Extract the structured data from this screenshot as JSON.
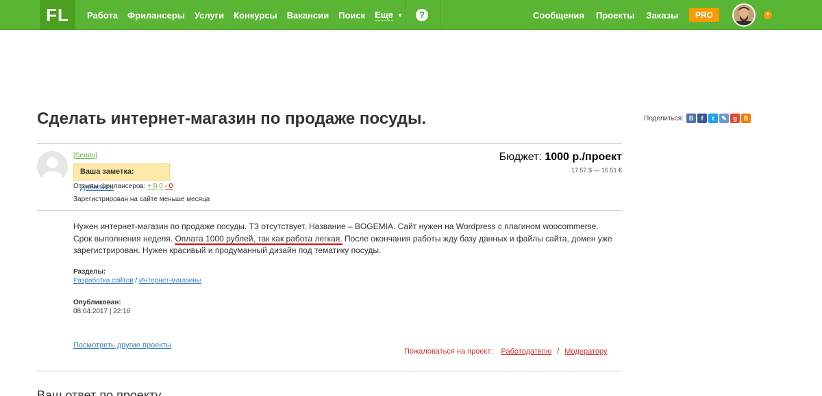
{
  "topbar": {
    "logo": "FL",
    "nav": [
      "Работа",
      "Фрилансеры",
      "Услуги",
      "Конкурсы",
      "Вакансии",
      "Поиск"
    ],
    "more": "Еще",
    "help": "?",
    "right_nav": [
      "Сообщения",
      "Проекты",
      "Заказы"
    ],
    "pro": "PRO"
  },
  "project": {
    "title": "Сделать интернет-магазин по продаже посуды.",
    "share_label": "Поделиться:",
    "share_buttons": [
      {
        "icon": "vk-icon",
        "glyph": "В",
        "color": "#4a76a8"
      },
      {
        "icon": "facebook-icon",
        "glyph": "f",
        "color": "#3b5998"
      },
      {
        "icon": "twitter-icon",
        "glyph": "t",
        "color": "#1da1f2"
      },
      {
        "icon": "link-icon",
        "glyph": "✎",
        "color": "#6c9bd2"
      },
      {
        "icon": "google-plus-icon",
        "glyph": "g",
        "color": "#dd4b39"
      },
      {
        "icon": "blogger-icon",
        "glyph": "B",
        "color": "#f57d00"
      }
    ],
    "user": "[Serutu]",
    "note_label": "Ваша заметка:",
    "note_add": "Добавить",
    "reviews_label": "Отзывы фрилансеров:",
    "reviews_pos": "+ 0",
    "reviews_neu": "0",
    "reviews_sep": "-",
    "reviews_neg": "- 0",
    "registered": "Зарегистрирован на сайте меньше месяца",
    "budget_label": "Бюджет:",
    "budget_value": "1000 р./проект",
    "budget_conv": "17.57 $ — 16.51 €",
    "desc_part1": "Нужен интернет-магазин по продаже посуды. ТЗ отсутствует. Название – BOGEMIA. Сайт нужен на Wordpress с плагином woocommerse. Срок выполнения неделя. ",
    "desc_marked": "Оплата 1000 рублей, так как  работа легкая.",
    "desc_part2": " После окончания работы жду базу данных и файлы сайта, домен уже зарегистрирован. Нужен красивый и продуманный дизайн под тематику посуды.",
    "sections_label": "Разделы:",
    "section1": "Разработка сайтов",
    "section_sep": " / ",
    "section2": "Интернет-магазины",
    "published_label": "Опубликован:",
    "published_date": "08.04.2017 | 22:16",
    "other_projects": "Посмотреть другие проекты",
    "complain_label": "Пожаловаться на проект:",
    "complain_employer": "Работодателю",
    "complain_sep": "/",
    "complain_moderator": "Модератору",
    "answer_title": "Ваш ответ по проекту"
  }
}
